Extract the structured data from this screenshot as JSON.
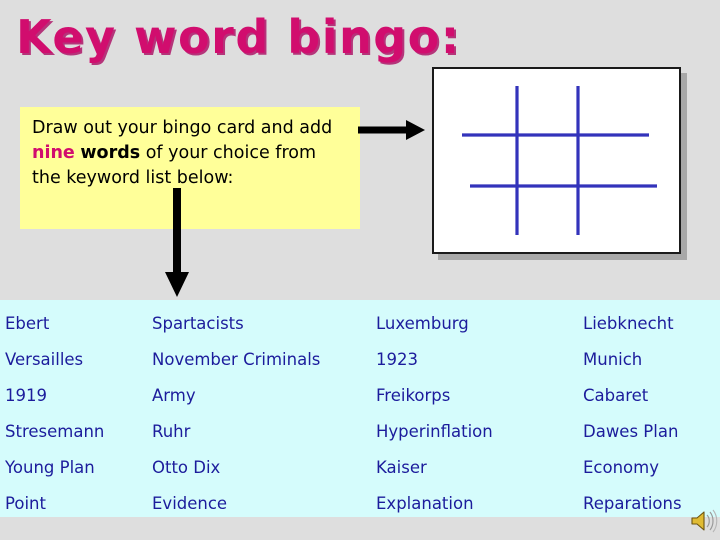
{
  "slide": {
    "title": "Key word bingo:",
    "background_color": "#dedede",
    "title_color": "#d10d6e"
  },
  "instruction": {
    "part1": "Draw out your bingo card and add ",
    "emphasis_pink": "nine",
    "space": " ",
    "emphasis_bold": "words",
    "part2": " of your choice from the keyword list below:",
    "box_color": "#ffff99"
  },
  "arrows": {
    "right_arrow_name": "arrow-right",
    "down_arrow_name": "arrow-down",
    "color": "#000000"
  },
  "bingo_card": {
    "label": "bingo-card",
    "grid_line_color": "#3333bb",
    "rows": 3,
    "columns": 3,
    "background": "#ffffff",
    "border_color": "#1a1a1a"
  },
  "keyword_list": {
    "background_color": "#d5fcfc",
    "text_color": "#1c1c9c",
    "columns": [
      {
        "words": [
          "Ebert",
          "Versailles",
          "1919",
          "Stresemann",
          "Young Plan",
          "Point"
        ]
      },
      {
        "words": [
          "Spartacists",
          "November Criminals",
          "Army",
          "Ruhr",
          "Otto Dix",
          "Evidence"
        ]
      },
      {
        "words": [
          "Luxemburg",
          "1923",
          "Freikorps",
          "Hyperinflation",
          "Kaiser",
          "Explanation"
        ]
      },
      {
        "words": [
          "Liebknecht",
          "Munich",
          "Cabaret",
          "Dawes Plan",
          "Economy",
          "Reparations"
        ]
      }
    ]
  },
  "media": {
    "speaker_icon_name": "speaker-icon",
    "speaker_color": "#d8a820"
  }
}
